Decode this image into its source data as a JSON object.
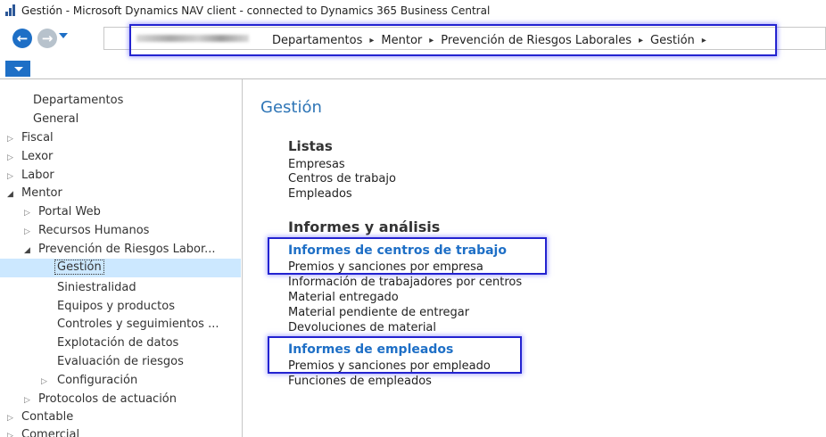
{
  "window": {
    "title": "Gestión - Microsoft Dynamics NAV client - connected to Dynamics 365 Business Central"
  },
  "nav": {
    "back_glyph": "←",
    "forward_glyph": "→",
    "breadcrumb": [
      "Departamentos",
      "Mentor",
      "Prevención de Riesgos Laborales",
      "Gestión"
    ],
    "separator": "▸"
  },
  "sidebar": {
    "items": [
      {
        "label": "Departamentos"
      },
      {
        "label": "General"
      },
      {
        "label": "Fiscal",
        "expander": "▷"
      },
      {
        "label": "Lexor",
        "expander": "▷"
      },
      {
        "label": "Labor",
        "expander": "▷"
      },
      {
        "label": "Mentor",
        "expander": "◢"
      },
      {
        "label": "Portal Web",
        "expander": "▷"
      },
      {
        "label": "Recursos Humanos",
        "expander": "▷"
      },
      {
        "label": "Prevención de Riesgos Labor...",
        "expander": "◢"
      },
      {
        "label": "Gestión"
      },
      {
        "label": "Siniestralidad"
      },
      {
        "label": "Equipos y productos"
      },
      {
        "label": "Controles y seguimientos ..."
      },
      {
        "label": "Explotación de datos"
      },
      {
        "label": "Evaluación de riesgos"
      },
      {
        "label": "Configuración",
        "expander": "▷"
      },
      {
        "label": "Protocolos de actuación",
        "expander": "▷"
      },
      {
        "label": "Contable",
        "expander": "▷"
      },
      {
        "label": "Comercial",
        "expander": "▷"
      }
    ]
  },
  "main": {
    "title": "Gestión",
    "listas": {
      "header": "Listas",
      "links": [
        "Empresas",
        "Centros de trabajo",
        "Empleados"
      ]
    },
    "informes": {
      "header": "Informes y análisis",
      "centros": {
        "header": "Informes de centros de trabajo",
        "links": [
          "Premios y sanciones por empresa",
          "Información de trabajadores por centros",
          "Material entregado",
          "Material pendiente de entregar",
          "Devoluciones de material"
        ]
      },
      "empleados": {
        "header": "Informes de empleados",
        "links": [
          "Premios y sanciones por empleado",
          "Funciones de empleados"
        ]
      }
    }
  },
  "colors": {
    "accent": "#1e6fc6",
    "highlight_box": "#2323d0",
    "selection": "#cce8ff",
    "title": "#2e75b6"
  }
}
